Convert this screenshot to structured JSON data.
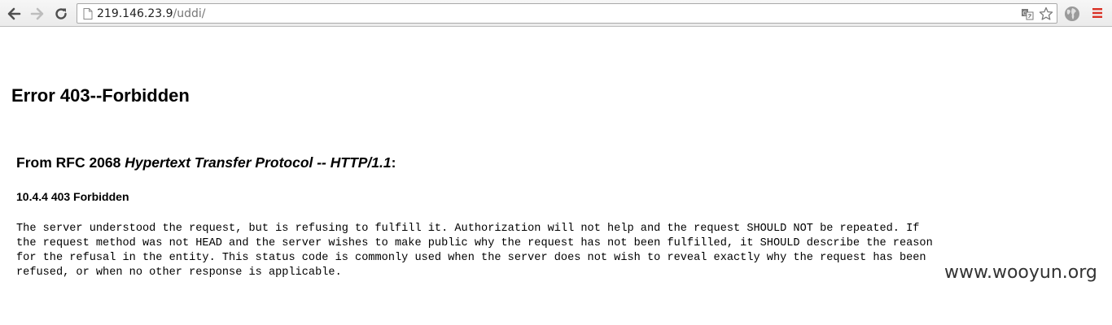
{
  "browser": {
    "url_host": "219.146.23.9",
    "url_path": "/uddi/",
    "icons": {
      "back": "back-arrow-icon",
      "forward": "forward-arrow-icon",
      "reload": "reload-icon",
      "page": "page-icon",
      "translate": "translate-icon",
      "bookmark": "star-icon",
      "extension": "globe-icon",
      "menu": "menu-icon"
    },
    "accent_color": "#d93025"
  },
  "page": {
    "title": "Error 403--Forbidden",
    "rfc_prefix": "From RFC 2068 ",
    "rfc_title": "Hypertext Transfer Protocol -- HTTP/1.1",
    "rfc_suffix": ":",
    "section": "10.4.4 403 Forbidden",
    "body_lines": [
      "The server understood the request, but is refusing to fulfill it. Authorization will not help and the request SHOULD NOT be repeated. If",
      "the request method was not HEAD and the server wishes to make public why the request has not been fulfilled, it SHOULD describe the reason",
      "for the refusal in the entity. This status code is commonly used when the server does not wish to reveal exactly why the request has been",
      "refused, or when no other response is applicable."
    ]
  },
  "watermark": "www.wooyun.org"
}
